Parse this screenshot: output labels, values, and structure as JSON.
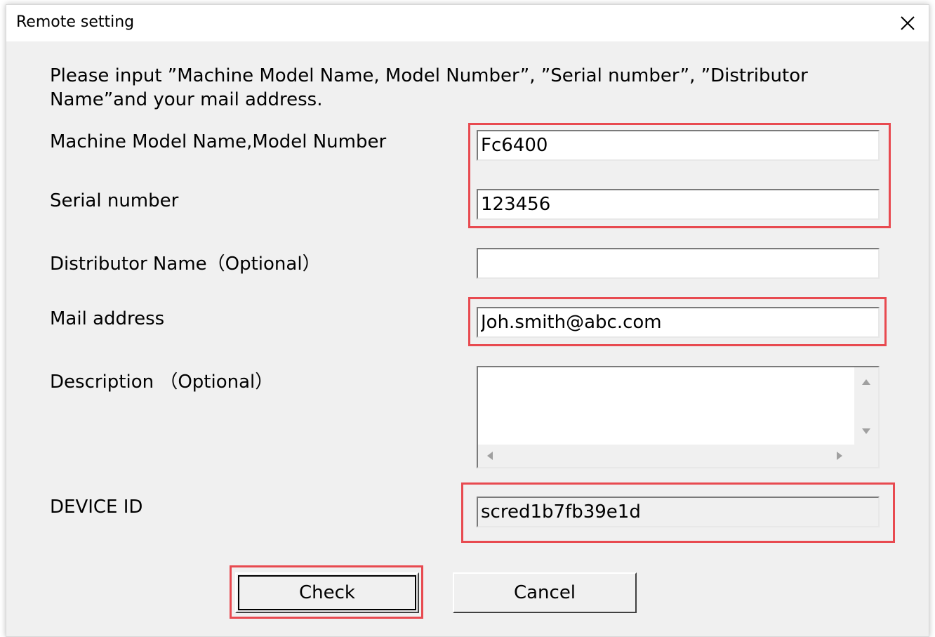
{
  "window": {
    "title": "Remote setting"
  },
  "intro": "Please input ”Machine Model Name, Model Number”, ”Serial number”, ”Distributor Name”and your mail address.",
  "fields": {
    "model": {
      "label": "Machine Model Name,Model Number",
      "value": "Fc6400"
    },
    "serial": {
      "label": "Serial number",
      "value": "123456"
    },
    "distributor": {
      "label": "Distributor Name（Optional）",
      "value": ""
    },
    "mail": {
      "label": "Mail address",
      "value": "Joh.smith@abc.com"
    },
    "description": {
      "label": "Description （Optional）",
      "value": ""
    },
    "device_id": {
      "label": "DEVICE ID",
      "value": "scred1b7fb39e1d"
    }
  },
  "buttons": {
    "check": "Check",
    "cancel": "Cancel"
  },
  "colors": {
    "highlight": "#e84a50",
    "dialog_bg": "#f0f0f0"
  },
  "icons": {
    "close": "close-icon",
    "scroll_up": "scroll-up-arrow-icon",
    "scroll_down": "scroll-down-arrow-icon",
    "scroll_left": "scroll-left-arrow-icon",
    "scroll_right": "scroll-right-arrow-icon"
  }
}
